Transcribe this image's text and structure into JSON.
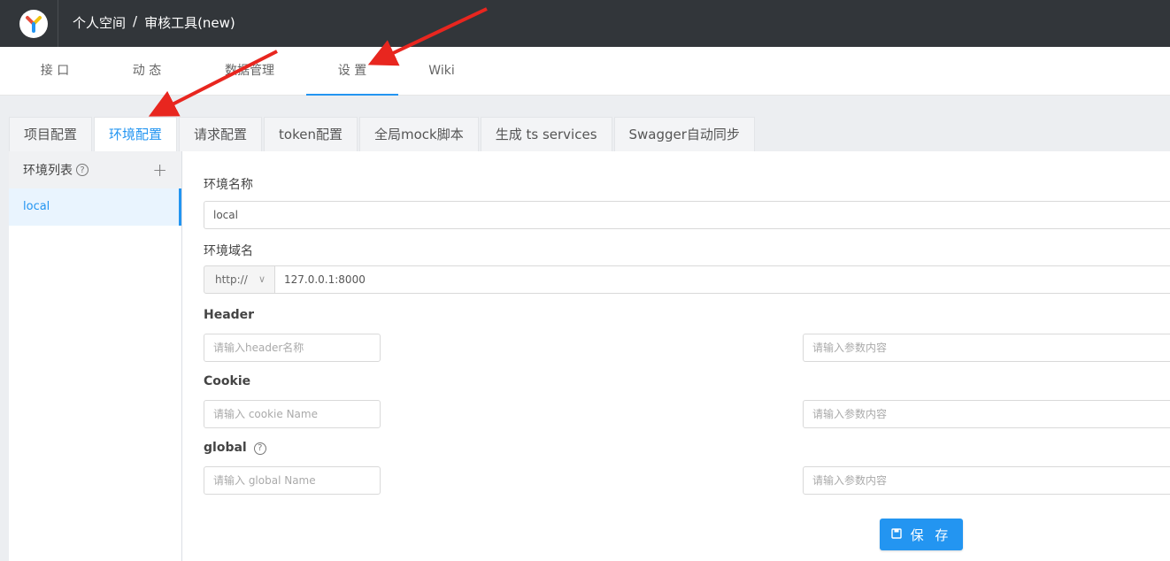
{
  "header": {
    "crumb_space": "个人空间",
    "crumb_sep": "/",
    "crumb_project": "审核工具(new)"
  },
  "subnav": [
    "接 口",
    "动 态",
    "数据管理",
    "设 置",
    "Wiki"
  ],
  "tabs": [
    "项目配置",
    "环境配置",
    "请求配置",
    "token配置",
    "全局mock脚本",
    "生成 ts services",
    "Swagger自动同步"
  ],
  "env_list": {
    "title": "环境列表",
    "items": [
      "local"
    ]
  },
  "form": {
    "env_name_label": "环境名称",
    "env_name_value": "local",
    "env_domain_label": "环境域名",
    "protocol": "http://",
    "domain_value": "127.0.0.1:8000",
    "header_label": "Header",
    "header_name_placeholder": "请输入header名称",
    "header_value_placeholder": "请输入参数内容",
    "cookie_label": "Cookie",
    "cookie_name_placeholder": "请输入 cookie Name",
    "cookie_value_placeholder": "请输入参数内容",
    "global_label": "global",
    "global_name_placeholder": "请输入 global Name",
    "global_value_placeholder": "请输入参数内容",
    "save_label": "保 存"
  },
  "colors": {
    "accent": "#2395f1",
    "header_bg": "#32363a",
    "annotation": "#e8261f"
  }
}
